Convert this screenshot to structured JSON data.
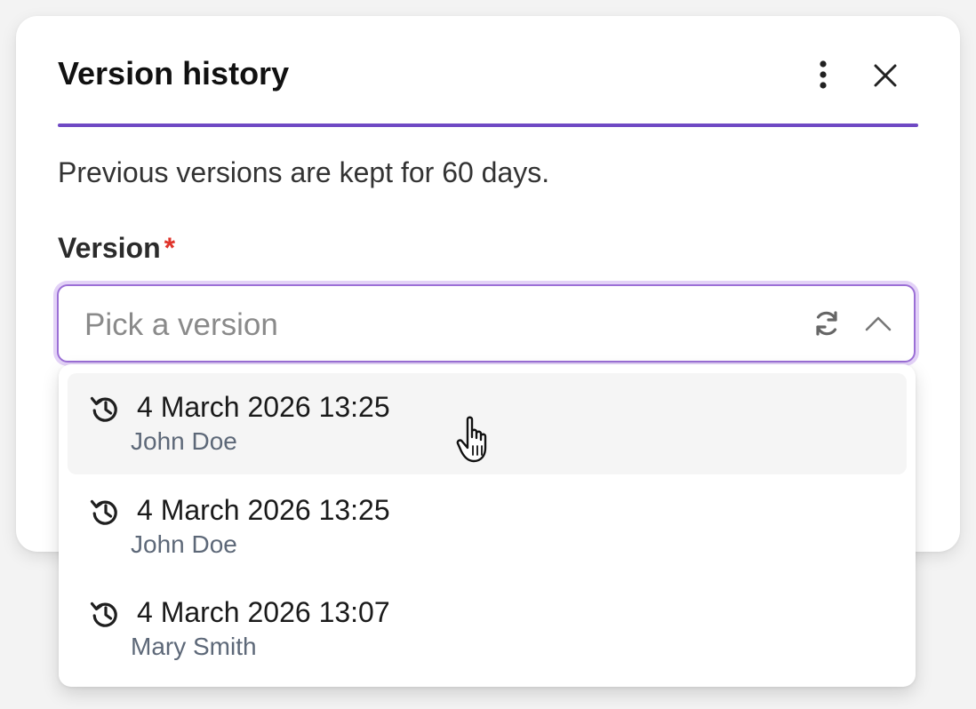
{
  "dialog": {
    "title": "Version history",
    "subtitle": "Previous versions are kept for 60 days.",
    "divider_color": "#6f49c4"
  },
  "field": {
    "label": "Version",
    "required_mark": "*",
    "placeholder": "Pick a version",
    "state": "open"
  },
  "options": [
    {
      "date": "4 March 2026 13:25",
      "user": "John Doe",
      "icon": "history-icon",
      "hovered": true
    },
    {
      "date": "4 March 2026 13:25",
      "user": "John Doe",
      "icon": "history-icon",
      "hovered": false
    },
    {
      "date": "4 March 2026 13:07",
      "user": "Mary Smith",
      "icon": "history-icon",
      "hovered": false
    }
  ],
  "icons": {
    "more": "more-vertical-icon",
    "close": "close-icon",
    "reload": "refresh-icon",
    "chevron": "chevron-up-icon"
  },
  "colors": {
    "accent": "#6f49c4",
    "focus_ring": "#e3d2f7",
    "required": "#e0342b"
  }
}
